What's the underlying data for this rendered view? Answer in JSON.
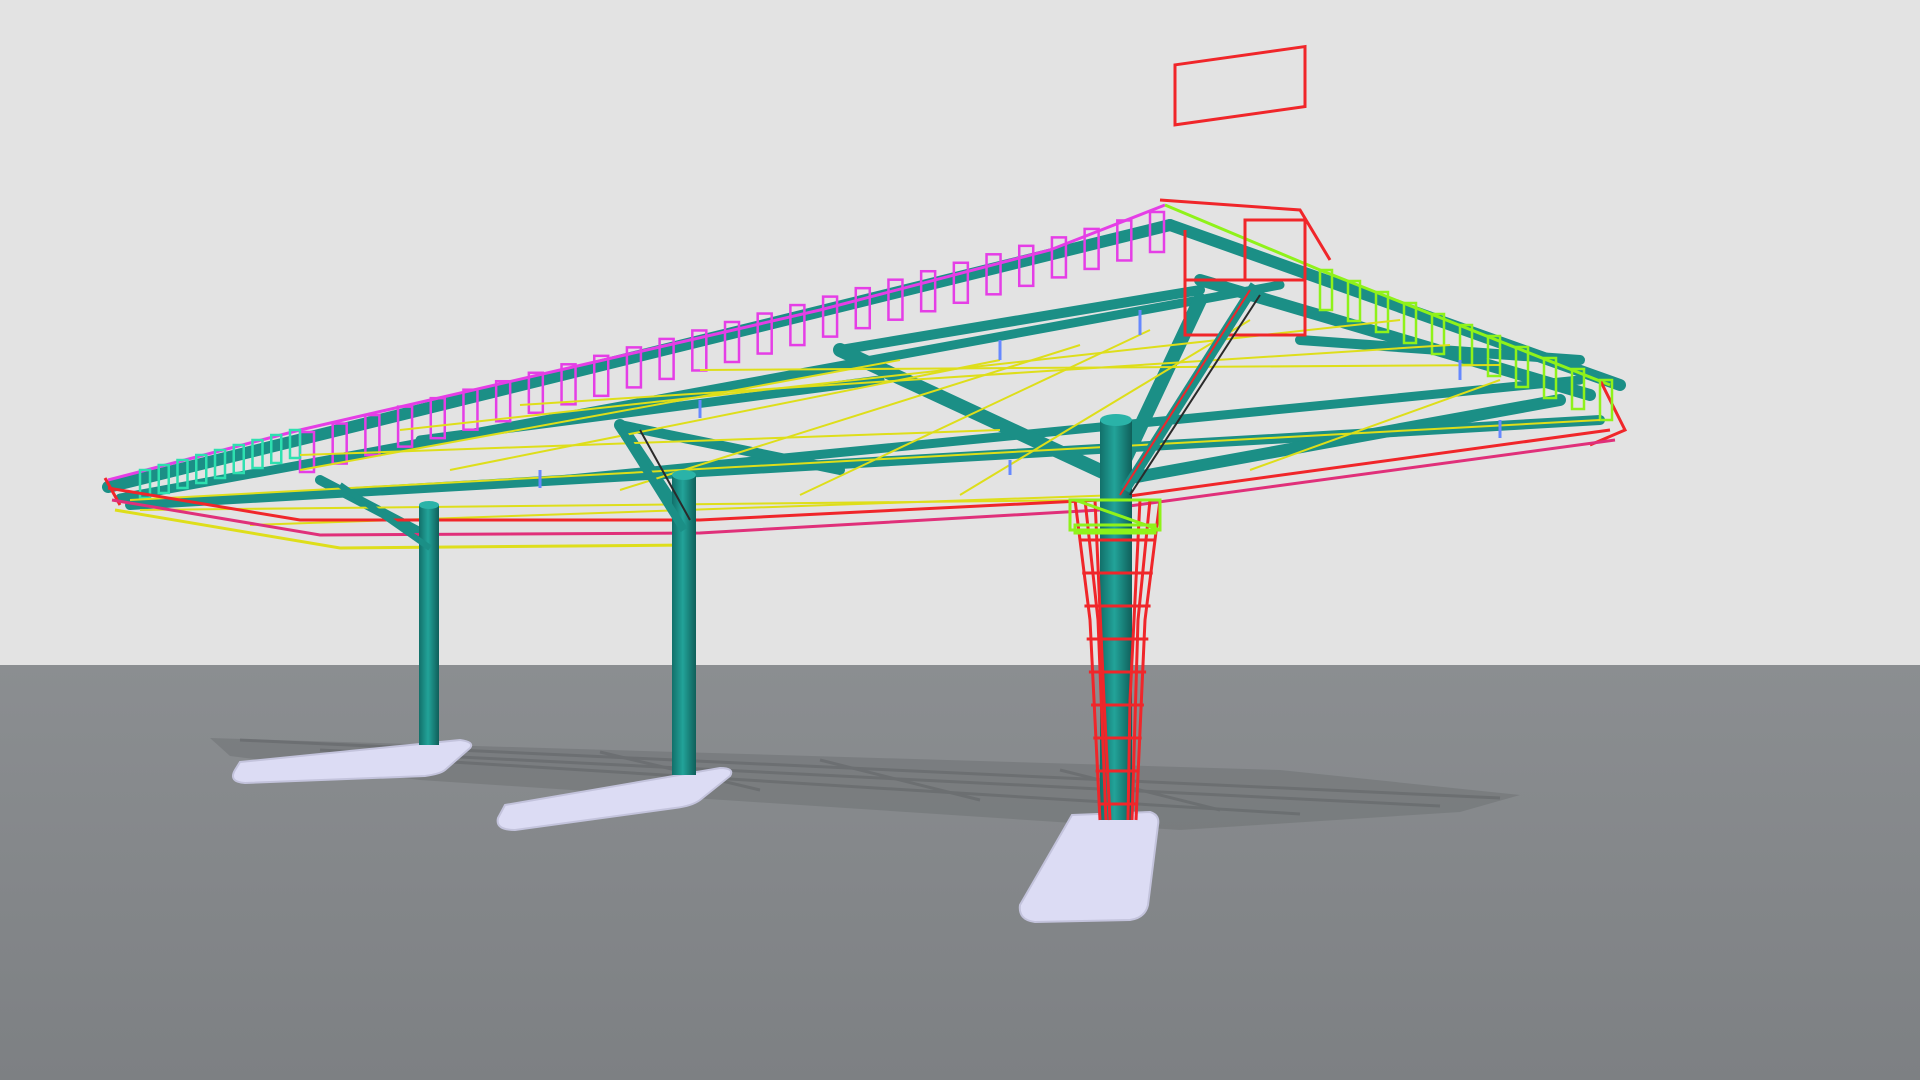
{
  "viewport": {
    "title": "",
    "object": "structural-canopy-model"
  },
  "colors": {
    "background_sky": "#e3e3e3",
    "ground": "#85888b",
    "steel": "#1b8f86",
    "footing": "#dcdcf4",
    "rebar_red": "#f0262a",
    "rebar_magenta": "#e53ee6",
    "rebar_green": "#8ff21a",
    "rebar_yellow": "#dede1a",
    "rebar_cyan": "#2ee0b0",
    "rebar_blue": "#6688ff"
  },
  "scene": {
    "columns": 3,
    "footings": 3,
    "roof_frame": "steel-beams-with-rebar-cages"
  }
}
